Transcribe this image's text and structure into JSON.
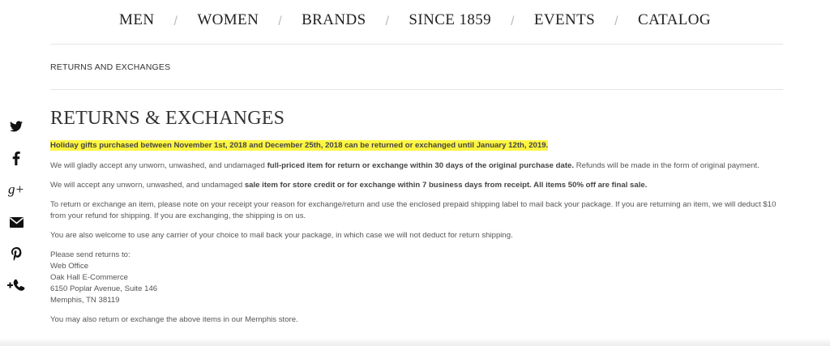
{
  "nav": {
    "items": [
      "MEN",
      "WOMEN",
      "BRANDS",
      "SINCE 1859",
      "EVENTS",
      "CATALOG"
    ],
    "separator": "/"
  },
  "breadcrumb": "RETURNS AND EXCHANGES",
  "social": {
    "icons": [
      "twitter-icon",
      "facebook-icon",
      "google-plus-icon",
      "email-icon",
      "pinterest-icon",
      "add-contact-icon"
    ]
  },
  "content": {
    "title": "RETURNS & EXCHANGES",
    "highlight": "Holiday gifts purchased between November 1st, 2018 and December 25th, 2018 can be returned or exchanged until January 12th, 2019.",
    "p1_pre": "We will gladly accept any unworn, unwashed, and undamaged ",
    "p1_bold": "full-priced item for return or exchange within 30 days of the original purchase date.",
    "p1_post": " Refunds will be made in the form of original payment.",
    "p2_pre": "We will accept any unworn, unwashed, and undamaged ",
    "p2_bold": "sale item for store credit or for exchange within 7 business days from receipt. All items 50% off are final sale.",
    "p3": "To return or exchange an item, please note on your receipt your reason for exchange/return and use the enclosed prepaid shipping label to mail back your package. If you are returning an item, we will deduct $10 from your refund for shipping. If you are exchanging, the shipping is on us.",
    "p4": "You are also welcome to use any carrier of your choice to mail back your package, in which case we will not deduct for return shipping.",
    "address": [
      "Please send returns to:",
      "Web Office",
      "Oak Hall E-Commerce",
      "6150 Poplar Avenue, Suite 146",
      "Memphis, TN 38119"
    ],
    "p5": "You may also return or exchange the above items in our Memphis store."
  },
  "colors": {
    "highlight": "#fdf542",
    "text": "#555555",
    "heading": "#333333"
  }
}
